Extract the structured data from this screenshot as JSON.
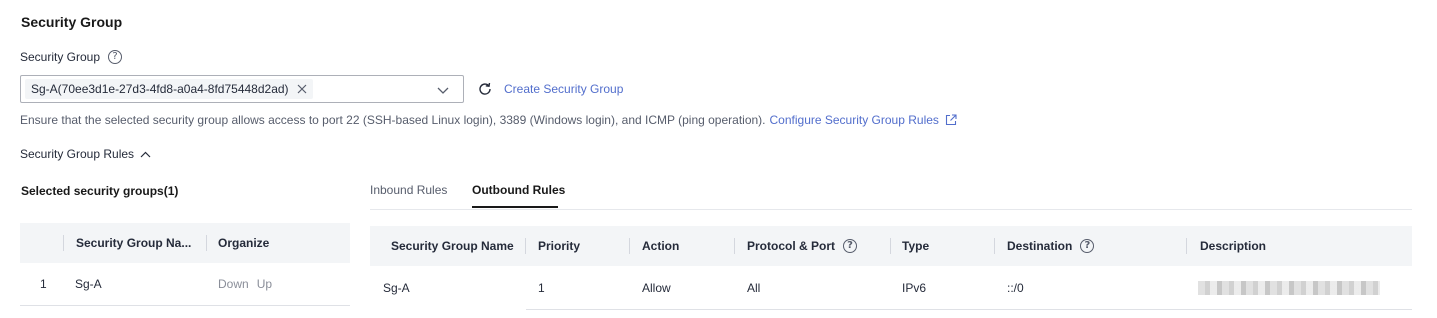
{
  "section_title": "Security Group",
  "field": {
    "label": "Security Group",
    "help_icon": "question-circle-icon",
    "selected_tag": "Sg-A(70ee3d1e-27d3-4fd8-a0a4-8fd75448d2ad)",
    "create_link": "Create Security Group"
  },
  "hint": {
    "text": "Ensure that the selected security group allows access to port 22 (SSH-based Linux login), 3389 (Windows login), and ICMP (ping operation).",
    "link": "Configure Security Group Rules"
  },
  "rules_toggle": "Security Group Rules",
  "left_panel": {
    "title": "Selected security groups(1)",
    "columns": [
      "Security Group Na...",
      "Organize"
    ],
    "rows": [
      {
        "index": "1",
        "name": "Sg-A",
        "down": "Down",
        "up": "Up"
      }
    ]
  },
  "tabs": [
    "Inbound Rules",
    "Outbound Rules"
  ],
  "active_tab": "Outbound Rules",
  "rules_table": {
    "columns": [
      "Security Group Name",
      "Priority",
      "Action",
      "Protocol & Port",
      "Type",
      "Destination",
      "Description"
    ],
    "rows": [
      {
        "name": "Sg-A",
        "priority": "1",
        "action": "Allow",
        "protocol_port": "All",
        "type": "IPv6",
        "destination": "::/0",
        "description": ""
      }
    ]
  },
  "colors": {
    "link": "#526ecc",
    "text": "#252b3a",
    "muted": "#575d6c",
    "header_bg": "#f3f5f7"
  }
}
